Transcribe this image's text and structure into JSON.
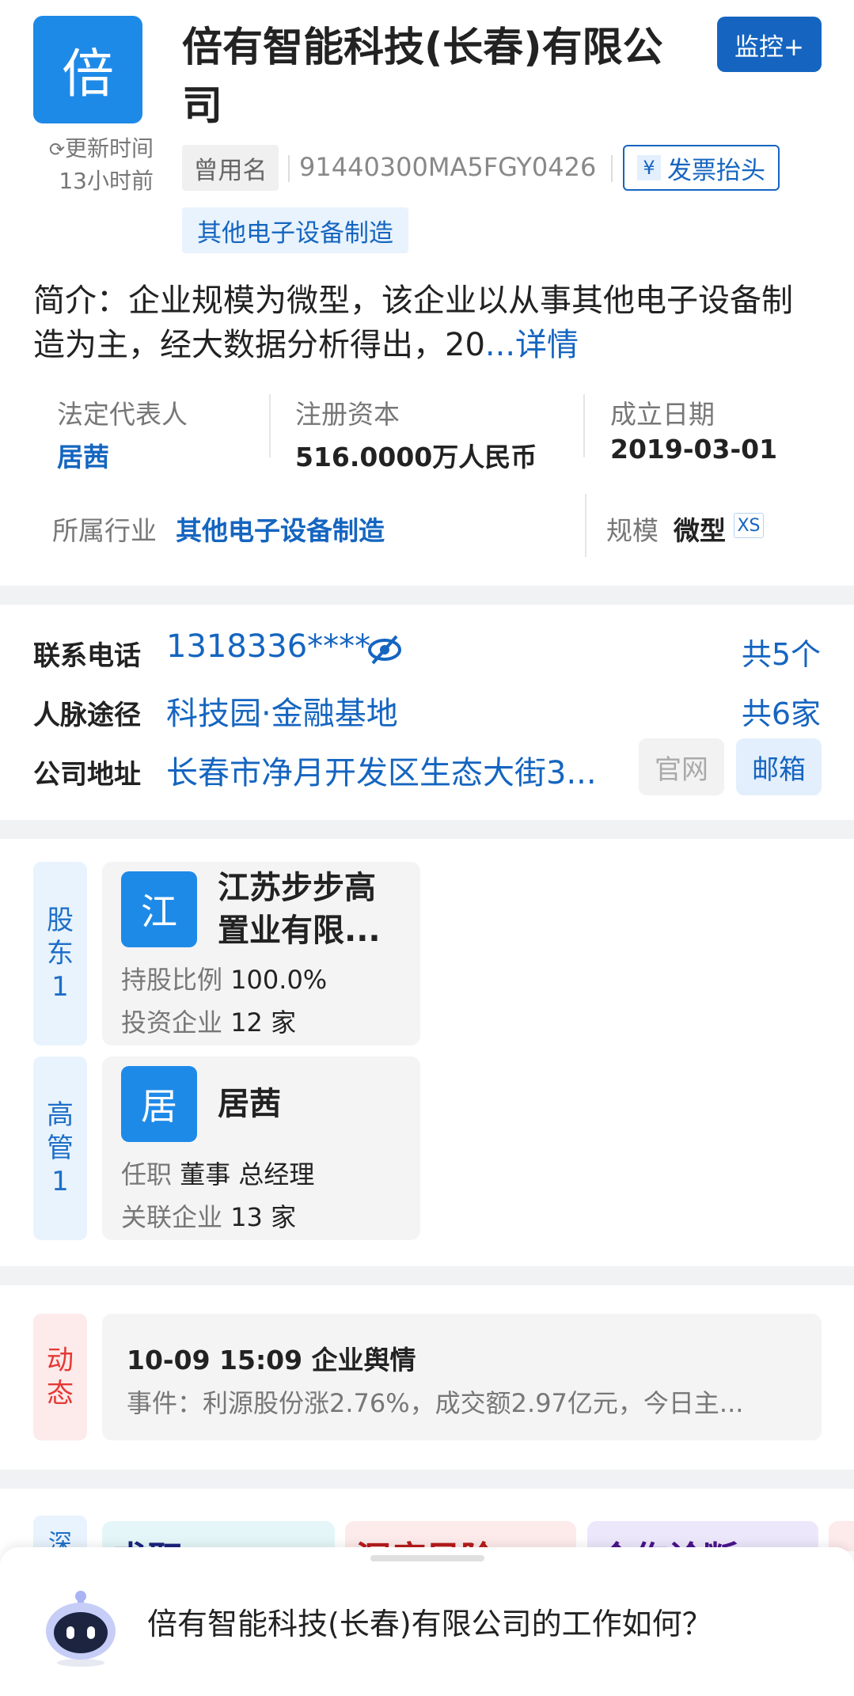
{
  "header": {
    "logo_char": "倍",
    "company_name": "倍有智能科技(长春)有限公司",
    "monitor_label": "监控+",
    "update_line1": "更新时间",
    "update_line2": "13小时前",
    "former_name_label": "曾用名",
    "credit_code": "91440300MA5FGY0426",
    "invoice_label": "发票抬头",
    "industry_tag": "其他电子设备制造"
  },
  "intro": {
    "text": "简介：企业规模为微型，该企业以从事其他电子设备制造为主，经大数据分析得出，20",
    "more": "...详情"
  },
  "info": {
    "legal_rep_label": "法定代表人",
    "legal_rep_value": "居茜",
    "capital_label": "注册资本",
    "capital_value": "516.0000万人民币",
    "founded_label": "成立日期",
    "founded_value": "2019-03-01",
    "industry_label": "所属行业",
    "industry_value": "其他电子设备制造",
    "scale_label": "规模",
    "scale_value": "微型",
    "scale_badge": "XS"
  },
  "contact": {
    "phone_label": "联系电话",
    "phone_value": "1318336****",
    "phone_count": "共5个",
    "network_label": "人脉途径",
    "network_value": "科技园·金融基地",
    "network_count": "共6家",
    "address_label": "公司地址",
    "address_value": "长春市净月开发区生态大街3...",
    "website_label": "官网",
    "email_label": "邮箱"
  },
  "shareholder": {
    "tab_label": "股东1",
    "avatar_char": "江",
    "name": "江苏步步高置业有限...",
    "ratio_label": "持股比例",
    "ratio_value": "100.0%",
    "invest_label": "投资企业",
    "invest_value": "12 家"
  },
  "executive": {
    "tab_label": "高管1",
    "avatar_char": "居",
    "name": "居茜",
    "position_label": "任职",
    "position_value": "董事 总经理",
    "related_label": "关联企业",
    "related_value": "13 家"
  },
  "news": {
    "tab_label": "动态",
    "headline": "10-09 15:09 企业舆情",
    "event": "事件：利源股份涨2.76%，成交额2.97亿元，今日主..."
  },
  "bottom_cards": {
    "side_label": "深",
    "items": [
      "求职",
      "深度风险",
      "合作诊断"
    ]
  },
  "ai_bar": {
    "question": "倍有智能科技(长春)有限公司的工作如何？"
  },
  "colors": {
    "brand_blue": "#1565c0",
    "logo_blue": "#1e8ae8",
    "news_red": "#e53935"
  }
}
